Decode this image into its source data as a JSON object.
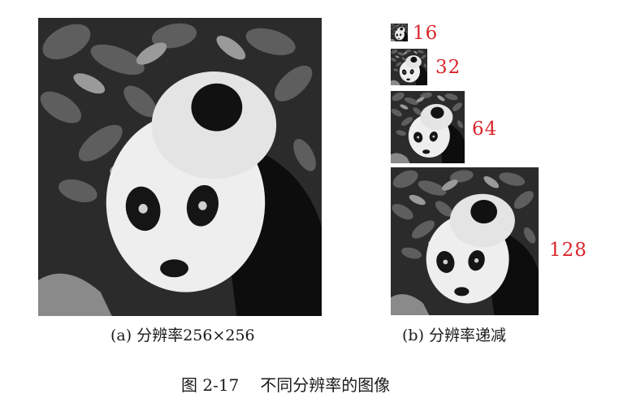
{
  "panel_a": {
    "caption": "(a) 分辨率256×256"
  },
  "panel_b": {
    "caption": "(b) 分辨率递减",
    "resolutions": [
      "16",
      "32",
      "64",
      "128"
    ]
  },
  "figure": {
    "number": "图 2-17",
    "title": "不同分辨率的图像"
  }
}
